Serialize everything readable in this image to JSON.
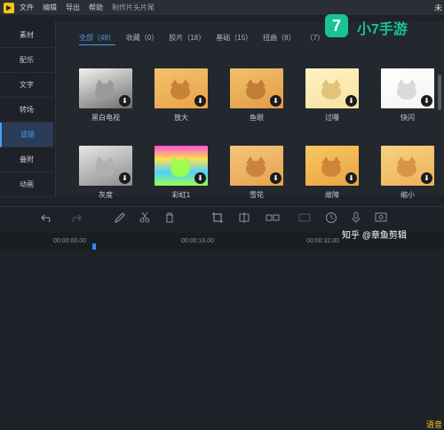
{
  "menubar": {
    "items": [
      "文件",
      "编辑",
      "导出",
      "帮助",
      "制作片头片尾"
    ],
    "window_title_fragment": "未"
  },
  "sidebar": {
    "items": [
      {
        "label": "素材",
        "active": false
      },
      {
        "label": "配乐",
        "active": false
      },
      {
        "label": "文字",
        "active": false
      },
      {
        "label": "转场",
        "active": false
      },
      {
        "label": "滤镜",
        "active": true
      },
      {
        "label": "叠附",
        "active": false
      },
      {
        "label": "动画",
        "active": false
      }
    ]
  },
  "tabs": [
    {
      "label": "全部（48）",
      "active": true
    },
    {
      "label": "收藏（0）",
      "active": false
    },
    {
      "label": "胶片（18）",
      "active": false
    },
    {
      "label": "基础（15）",
      "active": false
    },
    {
      "label": "扭曲（8）",
      "active": false
    },
    {
      "label": "（7）",
      "active": false
    }
  ],
  "filters": [
    {
      "label": "黑白电视",
      "colors": [
        "#f2f2f2",
        "#6c6c6c",
        "#9a9a9a"
      ]
    },
    {
      "label": "放大",
      "colors": [
        "#f1c36a",
        "#e9a24a",
        "#c9823a"
      ]
    },
    {
      "label": "鱼眼",
      "colors": [
        "#f0c26a",
        "#e49a46",
        "#c07c38"
      ]
    },
    {
      "label": "过曝",
      "colors": [
        "#fff3c4",
        "#f6e2a0",
        "#e3c27a"
      ]
    },
    {
      "label": "快闪",
      "colors": [
        "#ffffff",
        "#f4f4f4",
        "#d9d9d9"
      ]
    },
    {
      "label": "灰度",
      "colors": [
        "#e6e6e6",
        "#8c8c8c",
        "#b0b0b0"
      ]
    },
    {
      "label": "彩虹1",
      "colors": [
        "#ff4fd8",
        "#4fd1ff",
        "#9bff4f"
      ]
    },
    {
      "label": "雪花",
      "colors": [
        "#f3c77a",
        "#e8a14c",
        "#c8843c"
      ]
    },
    {
      "label": "故障",
      "colors": [
        "#f6c860",
        "#eba244",
        "#d08436"
      ]
    },
    {
      "label": "缩小",
      "colors": [
        "#f7d27f",
        "#efb05a",
        "#d89448"
      ]
    }
  ],
  "download_glyph": "⬇",
  "toolbar": {
    "icons": [
      "undo-icon",
      "redo-icon",
      "pen-icon",
      "scissors-icon",
      "trash-icon",
      "crop-icon",
      "split-icon",
      "group-icon",
      "stabilize-icon",
      "speed-icon",
      "mic-icon",
      "voice-icon"
    ],
    "right_text": "语音"
  },
  "timeline": {
    "timecodes": [
      "00:00:00.00",
      "00:00:16.00",
      "00:00:32.00"
    ]
  },
  "watermarks": {
    "site_logo": "7",
    "site_name": "小7手游",
    "zhihu": "知乎 @章鱼剪辑"
  },
  "colors": {
    "accent": "#4a9df0",
    "active_bg": "#2a3c56",
    "watermark_green": "#19c39a"
  }
}
